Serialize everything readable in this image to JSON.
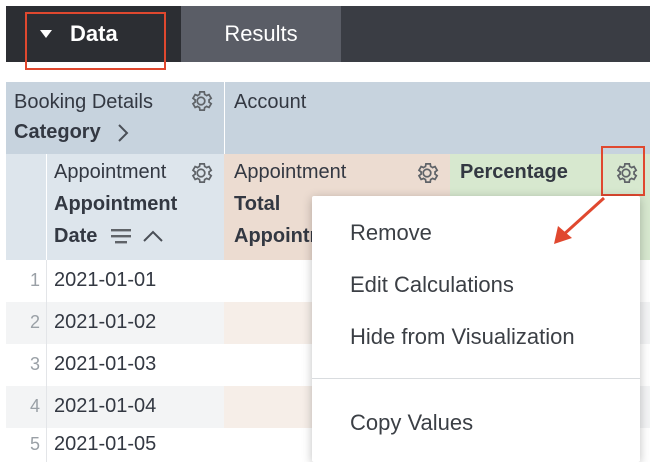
{
  "tabs": {
    "data_label": "Data",
    "results_label": "Results"
  },
  "header": {
    "booking_details": "Booking Details",
    "category": "Category",
    "account": "Account",
    "col1_title": "Appointment",
    "col1_sub1": "Appointment",
    "col1_sub2": "Date",
    "col2_title": "Appointment",
    "col2_sub1": "Total",
    "col2_sub2": "Appointm",
    "col3_title": "Percentage"
  },
  "rows": [
    {
      "num": "1",
      "date": "2021-01-01"
    },
    {
      "num": "2",
      "date": "2021-01-02"
    },
    {
      "num": "3",
      "date": "2021-01-03"
    },
    {
      "num": "4",
      "date": "2021-01-04"
    },
    {
      "num": "5",
      "date": "2021-01-05"
    }
  ],
  "menu": {
    "remove": "Remove",
    "edit": "Edit Calculations",
    "hide": "Hide from Visualization",
    "copy": "Copy Values"
  },
  "colors": {
    "header_blue": "#c7d3de",
    "dimension_blue": "#dde5ec",
    "measure_tan": "#ecdcd1",
    "table_calc_green": "#d7e8cf",
    "highlight_red": "#e0482f"
  }
}
